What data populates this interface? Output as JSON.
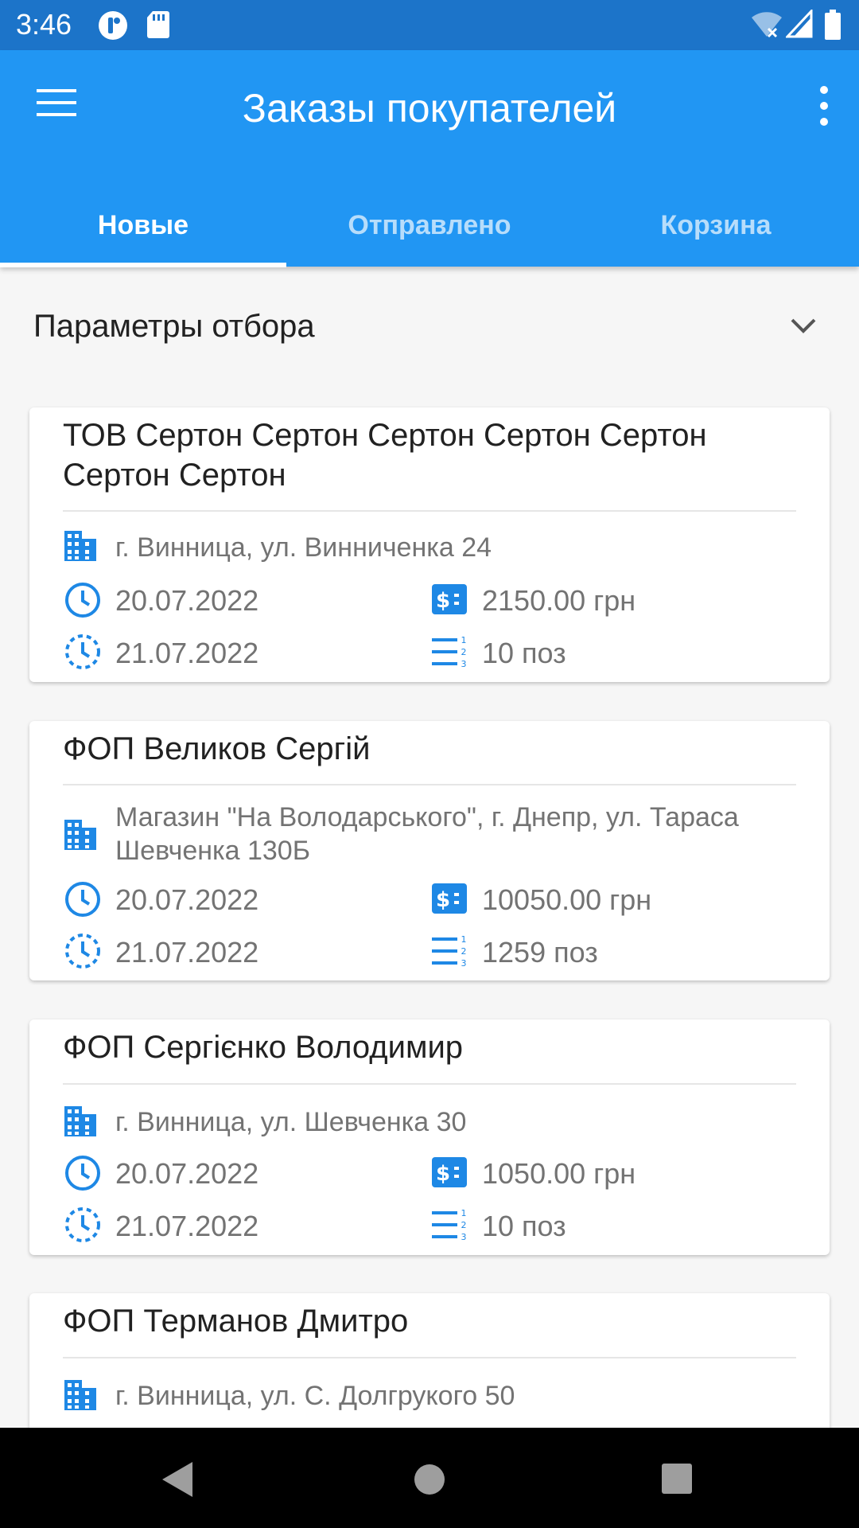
{
  "status_bar": {
    "time": "3:46"
  },
  "app_bar": {
    "title": "Заказы покупателей",
    "menu_icon": "hamburger-menu-icon",
    "more_icon": "more-vert-icon"
  },
  "tabs": [
    {
      "label": "Новые",
      "active": true
    },
    {
      "label": "Отправлено",
      "active": false
    },
    {
      "label": "Корзина",
      "active": false
    }
  ],
  "filter": {
    "label": "Параметры отбора"
  },
  "colors": {
    "primary": "#2196f3",
    "status": "#1c74c9",
    "icon_blue": "#1e88e5"
  },
  "orders": [
    {
      "customer": "ТОВ Сертон Сертон Сертон Сертон Сертон Сертон Сертон",
      "address": "г. Винница, ул. Винниченка 24",
      "date_created": "20.07.2022",
      "date_shipped": "21.07.2022",
      "amount": "2150.00 грн",
      "positions": "10 поз"
    },
    {
      "customer": "ФОП Великов Сергій",
      "address": "Магазин \"На Володарського\", г. Днепр, ул. Тараса Шевченка 130Б",
      "date_created": "20.07.2022",
      "date_shipped": "21.07.2022",
      "amount": "10050.00 грн",
      "positions": "1259 поз"
    },
    {
      "customer": "ФОП Сергієнко Володимир",
      "address": "г. Винница, ул. Шевченка 30",
      "date_created": "20.07.2022",
      "date_shipped": "21.07.2022",
      "amount": "1050.00 грн",
      "positions": "10 поз"
    },
    {
      "customer": "ФОП Терманов Дмитро",
      "address": "г. Винница, ул. С. Долгрукого 50"
    }
  ]
}
